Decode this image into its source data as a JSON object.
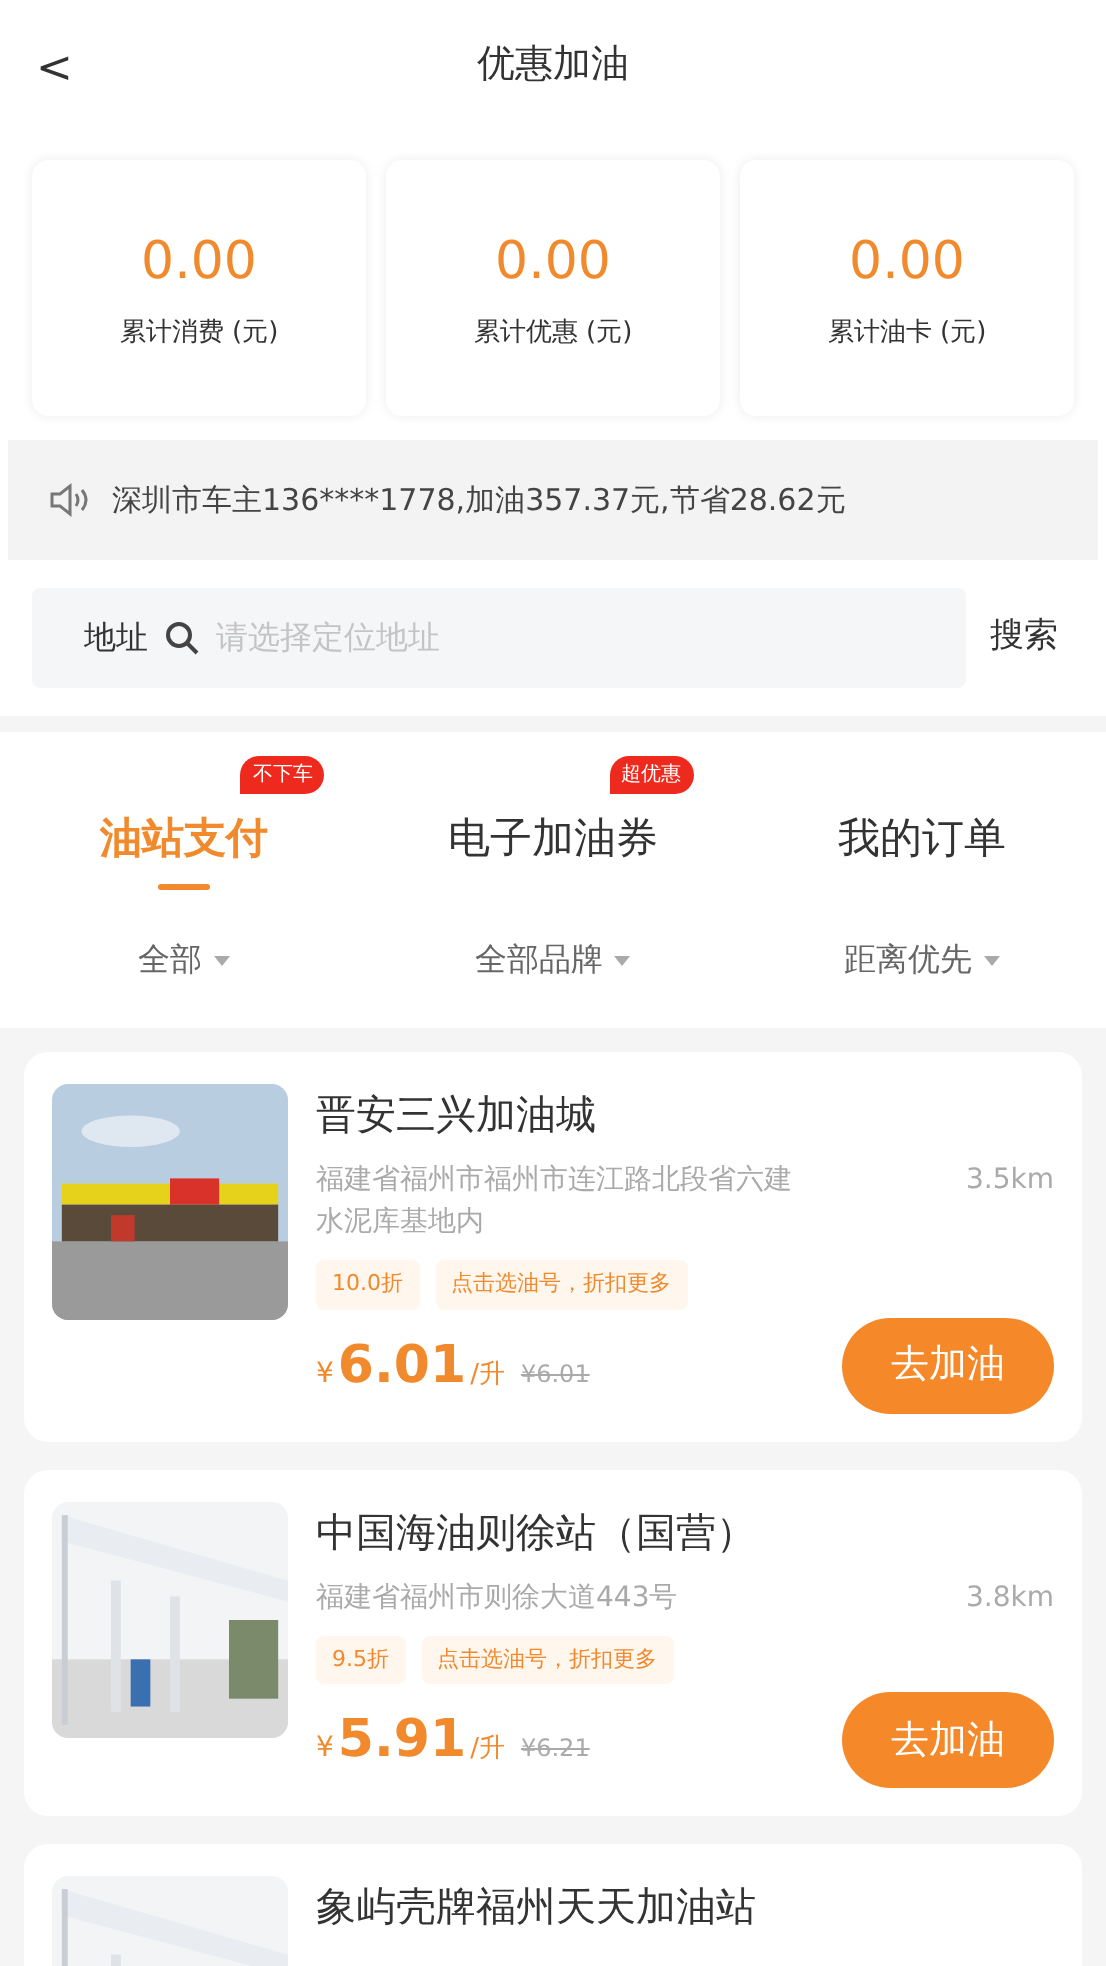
{
  "header": {
    "back": "<",
    "title": "优惠加油"
  },
  "stats": [
    {
      "value": "0.00",
      "label": "累计消费 (元)"
    },
    {
      "value": "0.00",
      "label": "累计优惠 (元)"
    },
    {
      "value": "0.00",
      "label": "累计油卡 (元)"
    }
  ],
  "notice": "深圳市车主136****1778,加油357.37元,节省28.62元",
  "search": {
    "label": "地址",
    "placeholder": "请选择定位地址",
    "button": "搜索"
  },
  "tabs": [
    {
      "label": "油站支付",
      "badge": "不下车",
      "selected": true
    },
    {
      "label": "电子加油券",
      "badge": "超优惠",
      "selected": false
    },
    {
      "label": "我的订单",
      "selected": false
    }
  ],
  "filters": [
    "全部",
    "全部品牌",
    "距离优先"
  ],
  "stations": [
    {
      "name": "晋安三兴加油城",
      "address": "福建省福州市福州市连江路北段省六建水泥库基地内",
      "distance": "3.5km",
      "discount": "10.0折",
      "promo": "点击选油号，折扣更多",
      "currency": "¥",
      "price": "6.01",
      "unit": "/升",
      "old_price": "¥6.01",
      "button": "去加油"
    },
    {
      "name": "中国海油则徐站（国营）",
      "address": "福建省福州市则徐大道443号",
      "distance": "3.8km",
      "discount": "9.5折",
      "promo": "点击选油号，折扣更多",
      "currency": "¥",
      "price": "5.91",
      "unit": "/升",
      "old_price": "¥6.21",
      "button": "去加油"
    },
    {
      "name": "象屿壳牌福州天天加油站"
    }
  ]
}
